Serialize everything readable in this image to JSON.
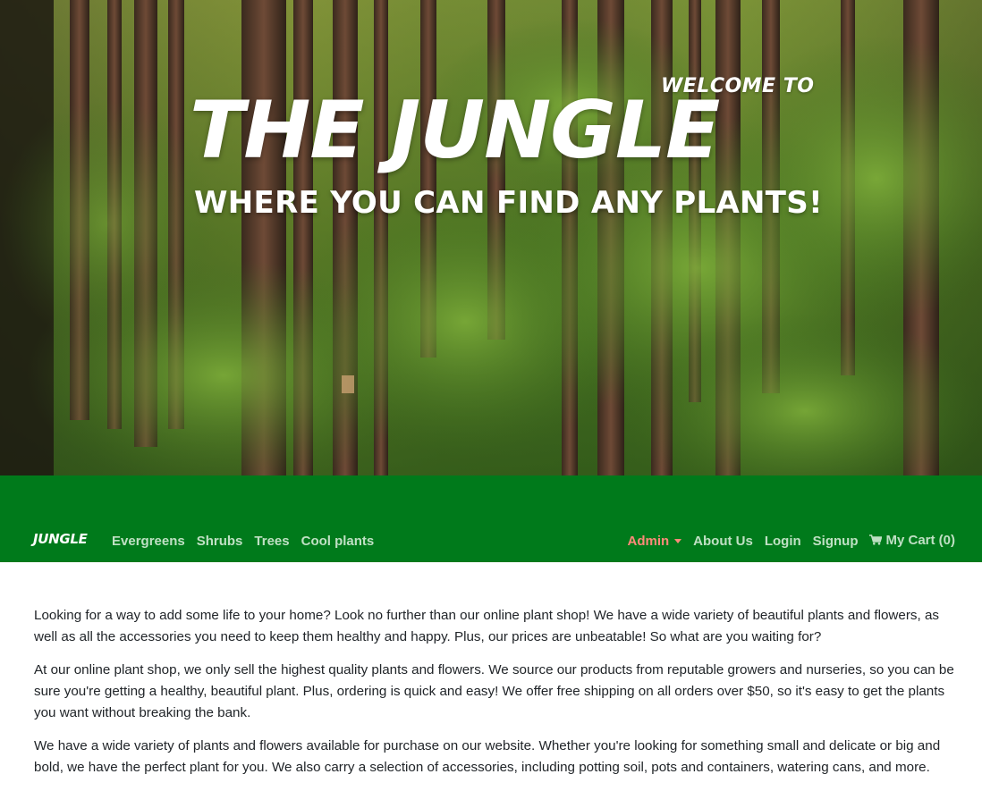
{
  "hero": {
    "welcome": "WELCOME TO",
    "title": "THE JUNGLE",
    "subtitle": "WHERE YOU CAN FIND ANY PLANTS!"
  },
  "navbar": {
    "brand": "JUNGLE",
    "left_links": [
      {
        "label": "Evergreens"
      },
      {
        "label": "Shrubs"
      },
      {
        "label": "Trees"
      },
      {
        "label": "Cool plants"
      }
    ],
    "admin_label": "Admin",
    "right_links": [
      {
        "label": "About Us"
      },
      {
        "label": "Login"
      },
      {
        "label": "Signup"
      }
    ],
    "cart_label": "My Cart (0)"
  },
  "content": {
    "paragraphs": [
      "Looking for a way to add some life to your home? Look no further than our online plant shop! We have a wide variety of beautiful plants and flowers, as well as all the accessories you need to keep them healthy and happy. Plus, our prices are unbeatable! So what are you waiting for?",
      "At our online plant shop, we only sell the highest quality plants and flowers. We source our products from reputable growers and nurseries, so you can be sure you're getting a healthy, beautiful plant. Plus, ordering is quick and easy! We offer free shipping on all orders over $50, so it's easy to get the plants you want without breaking the bank.",
      "We have a wide variety of plants and flowers available for purchase on our website. Whether you're looking for something small and delicate or big and bold, we have the perfect plant for you. We also carry a selection of accessories, including potting soil, pots and containers, watering cans, and more."
    ]
  },
  "colors": {
    "navbar_bg": "#007a1b",
    "nav_link": "#bfe0c4",
    "admin_link": "#ff8a7a",
    "body_text": "#212529"
  }
}
